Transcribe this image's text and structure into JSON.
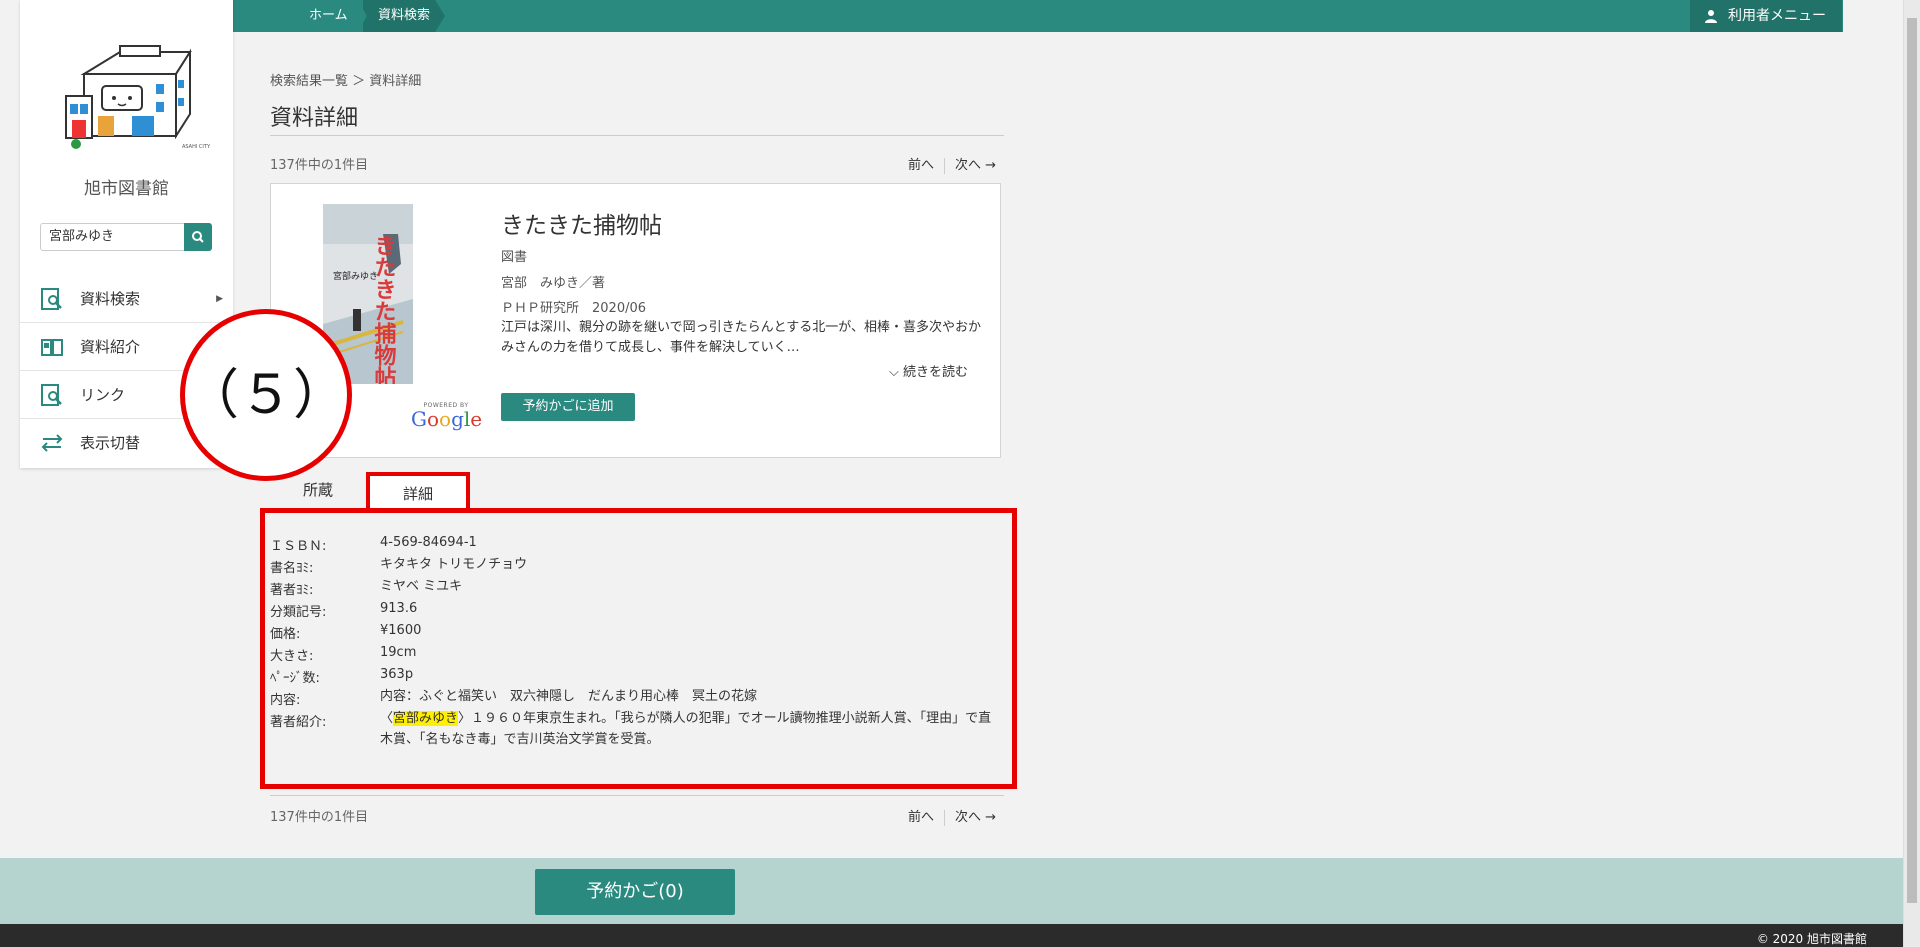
{
  "topbar": {
    "breadcrumb_home": "ホーム",
    "breadcrumb_current": "資料検索",
    "user_menu": "利用者メニュー"
  },
  "sidebar": {
    "library_name": "旭市図書館",
    "search_value": "宮部みゆき",
    "items": [
      {
        "label": "資料検索",
        "icon": "search-book-icon"
      },
      {
        "label": "資料紹介",
        "icon": "open-book-icon"
      },
      {
        "label": "リンク",
        "icon": "search-book-icon"
      },
      {
        "label": "表示切替",
        "icon": "swap-arrows-icon"
      }
    ]
  },
  "main": {
    "breadcrumb": "検索結果一覧 ＞ 資料詳細",
    "page_title": "資料詳細",
    "count": "137件中の1件目",
    "prev": "前へ",
    "next": "次へ →"
  },
  "book": {
    "title": "きたきた捕物帖",
    "type": "図書",
    "author": "宮部　みゆき／著",
    "publisher": "ＰＨＰ研究所　2020/06",
    "desc": "江戸は深川、親分の跡を継いで岡っ引きたらんとする北一が、相棒・喜多次やおかみさんの力を借りて成長し、事件を解決していく…",
    "read_more": "続きを読む",
    "reserve_button": "予約かごに追加",
    "powered_by": "POWERED BY",
    "google": "Google",
    "cover_title": "きたきた捕物帖",
    "cover_author": "宮部みゆき"
  },
  "tabs": {
    "holdings": "所蔵",
    "detail": "詳細"
  },
  "details": [
    {
      "label": "ＩＳＢＮ:",
      "value": "4-569-84694-1"
    },
    {
      "label": "書名ﾖﾐ:",
      "value": "キタキタ トリモノチョウ"
    },
    {
      "label": "著者ﾖﾐ:",
      "value": "ミヤベ ミユキ"
    },
    {
      "label": "分類記号:",
      "value": "913.6"
    },
    {
      "label": "価格:",
      "value": "¥1600"
    },
    {
      "label": "大きさ:",
      "value": "19cm"
    },
    {
      "label": "ﾍﾟｰｼﾞ数:",
      "value": "363p"
    },
    {
      "label": "内容:",
      "value": "内容：ふぐと福笑い　双六神隠し　だんまり用心棒　冥土の花嫁"
    },
    {
      "label": "著者紹介:",
      "value_pre": "〈",
      "value_hl": "宮部みゆき",
      "value_post": "〉１９６０年東京生まれ。「我らが隣人の犯罪」でオール讀物推理小説新人賞、「理由」で直木賞、「名もなき毒」で吉川英治文学賞を受賞。"
    }
  ],
  "annotation": "（５）",
  "footer": {
    "cart_button": "予約かご(0)",
    "copyright": "© 2020 旭市図書館"
  },
  "colors": {
    "accent": "#2a8a80",
    "accent_dark": "#217369",
    "annotation_red": "#e60000",
    "footer_band": "#b5d3cf",
    "highlight": "#ffef00"
  }
}
